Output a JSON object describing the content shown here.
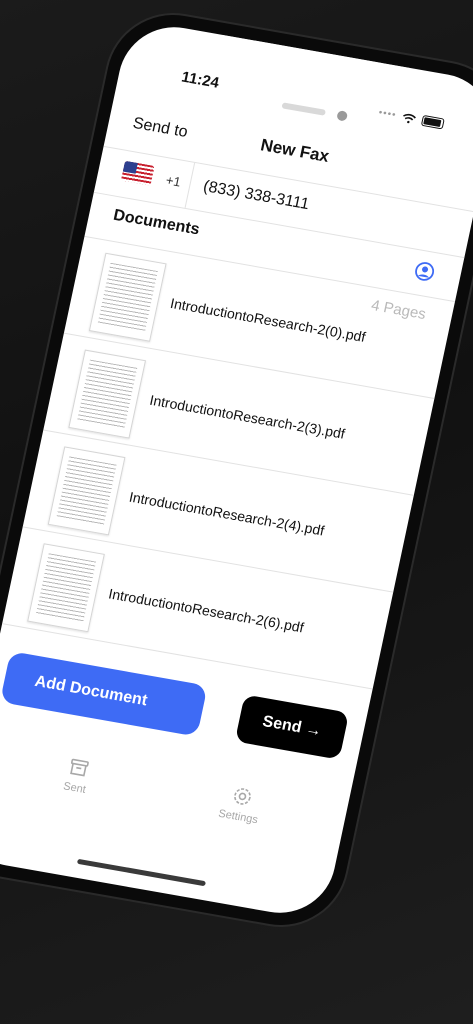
{
  "status_bar": {
    "time": "11:24",
    "signal": "••••"
  },
  "header": {
    "title": "New Fax",
    "send_to_label": "Send to"
  },
  "recipient": {
    "country_code": "+1",
    "fax_number": "(833) 338-3111"
  },
  "documents": {
    "label": "Documents",
    "pages_label": "4 Pages",
    "items": [
      {
        "name": "IntroductiontoResearch-2(0).pdf"
      },
      {
        "name": "IntroductiontoResearch-2(3).pdf"
      },
      {
        "name": "IntroductiontoResearch-2(4).pdf"
      },
      {
        "name": "IntroductiontoResearch-2(6).pdf"
      }
    ]
  },
  "actions": {
    "add_document": "Add Document",
    "send": "Send →"
  },
  "tabs": {
    "sent": "Sent",
    "settings": "Settings"
  },
  "colors": {
    "accent": "#3e6bf5",
    "send_button": "#000000",
    "muted": "#a8a8a8"
  }
}
